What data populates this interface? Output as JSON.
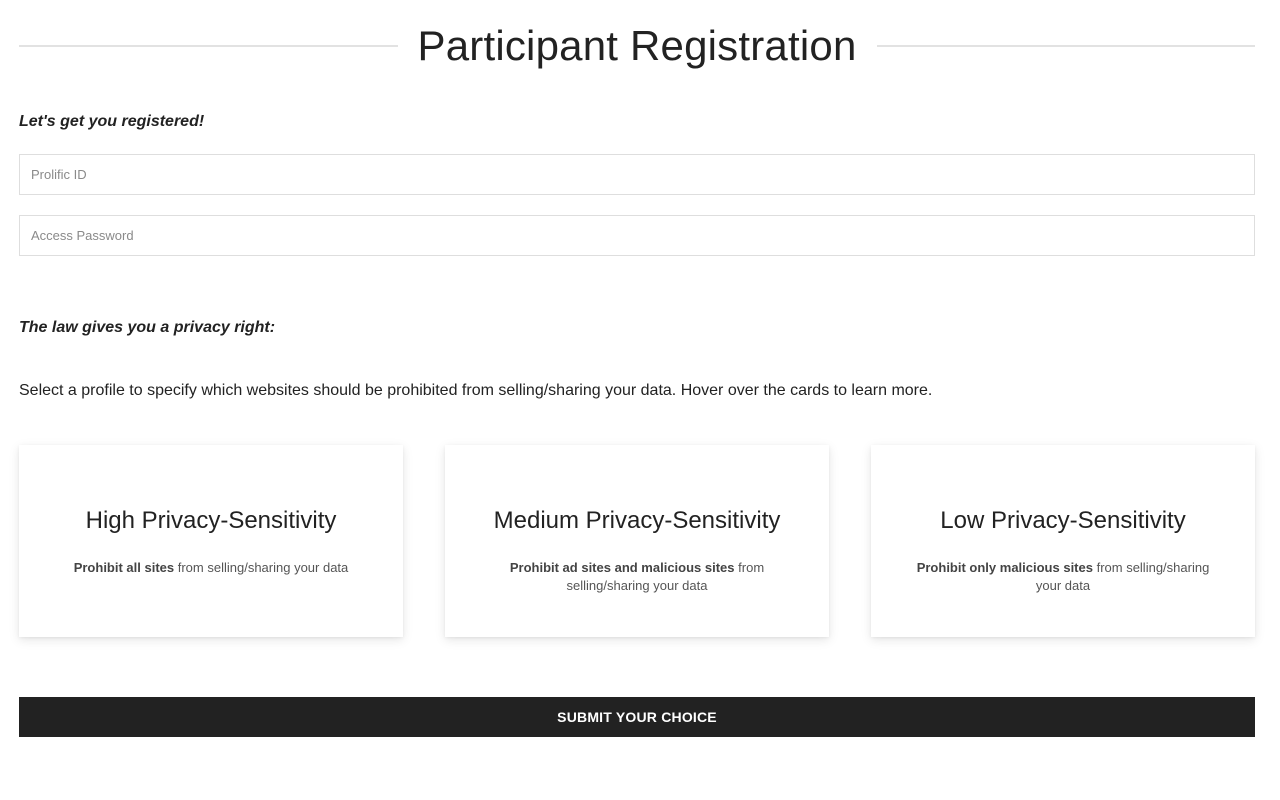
{
  "header": {
    "title": "Participant Registration"
  },
  "registration": {
    "heading": "Let's get you registered!",
    "prolific_id": {
      "value": "",
      "placeholder": "Prolific ID"
    },
    "access_password": {
      "value": "",
      "placeholder": "Access Password"
    }
  },
  "privacy": {
    "heading": "The law gives you a privacy right:",
    "instructions": "Select a profile to specify which websites should be prohibited from selling/sharing your data. Hover over the cards to learn more.",
    "profiles": [
      {
        "title": "High Privacy-Sensitivity",
        "desc_bold": "Prohibit all sites",
        "desc_rest": " from selling/sharing your data"
      },
      {
        "title": "Medium Privacy-Sensitivity",
        "desc_bold": "Prohibit ad sites and malicious sites",
        "desc_rest": " from selling/sharing your data"
      },
      {
        "title": "Low Privacy-Sensitivity",
        "desc_bold": "Prohibit only malicious sites",
        "desc_rest": " from selling/sharing your data"
      }
    ]
  },
  "submit": {
    "label": "SUBMIT YOUR CHOICE"
  },
  "colors": {
    "button_bg": "#222222",
    "text": "#222222",
    "divider": "#e2e2e2",
    "input_border": "#dedede"
  }
}
